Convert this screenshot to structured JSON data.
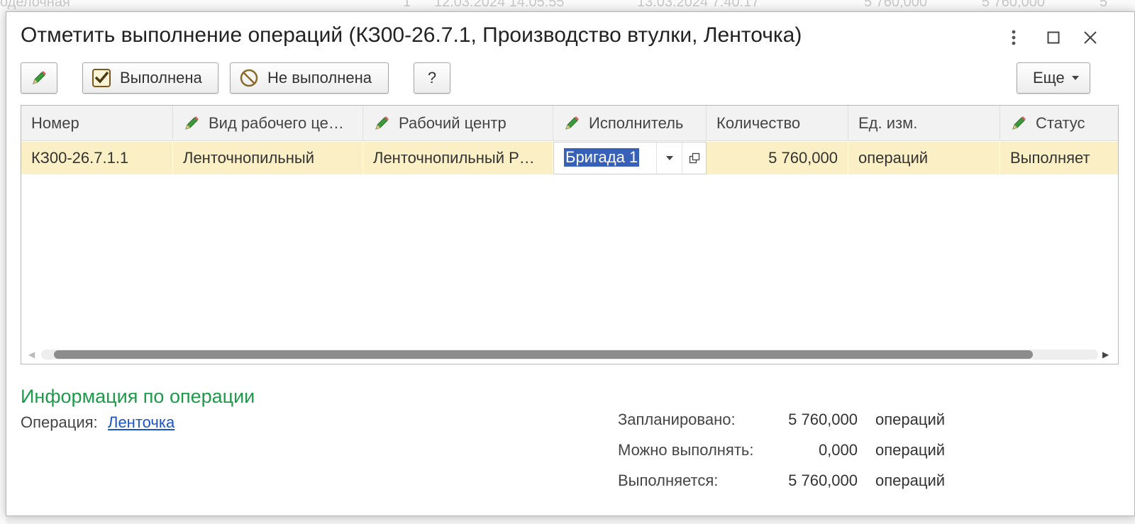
{
  "background": {
    "fragments": [
      "оделочная",
      "1",
      "12.03.2024 14:05:55",
      "13.03.2024 7:40:17",
      "5 760,000",
      "5 760,000",
      "5"
    ]
  },
  "dialog": {
    "title": "Отметить выполнение операций (КЗ00-26.7.1, Производство втулки, Ленточка)"
  },
  "toolbar": {
    "done_label": "Выполнена",
    "not_done_label": "Не выполнена",
    "help_label": "?",
    "more_label": "Еще"
  },
  "table": {
    "columns": [
      "Номер",
      "Вид рабочего це…",
      "Рабочий центр",
      "Исполнитель",
      "Количество",
      "Ед. изм.",
      "Статус"
    ],
    "rows": [
      {
        "number": "КЗ00-26.7.1.1",
        "work_center_type": "Ленточнопильный",
        "work_center": "Ленточнопильный Р…",
        "executor": "Бригада 1",
        "quantity": "5 760,000",
        "unit": "операций",
        "status": "Выполняет"
      }
    ]
  },
  "info": {
    "title": "Информация по операции",
    "operation_label": "Операция:",
    "operation_link": "Ленточка",
    "planned_label": "Запланировано:",
    "planned_value": "5 760,000",
    "planned_unit": "операций",
    "can_do_label": "Можно выполнять:",
    "can_do_value": "0,000",
    "can_do_unit": "операций",
    "in_progress_label": "Выполняется:",
    "in_progress_value": "5 760,000",
    "in_progress_unit": "операций"
  },
  "colors": {
    "accent_green": "#1e9a4a",
    "link_blue": "#1b55c9",
    "selected_row": "#fbf0c5",
    "selection_highlight": "#3760b8"
  }
}
